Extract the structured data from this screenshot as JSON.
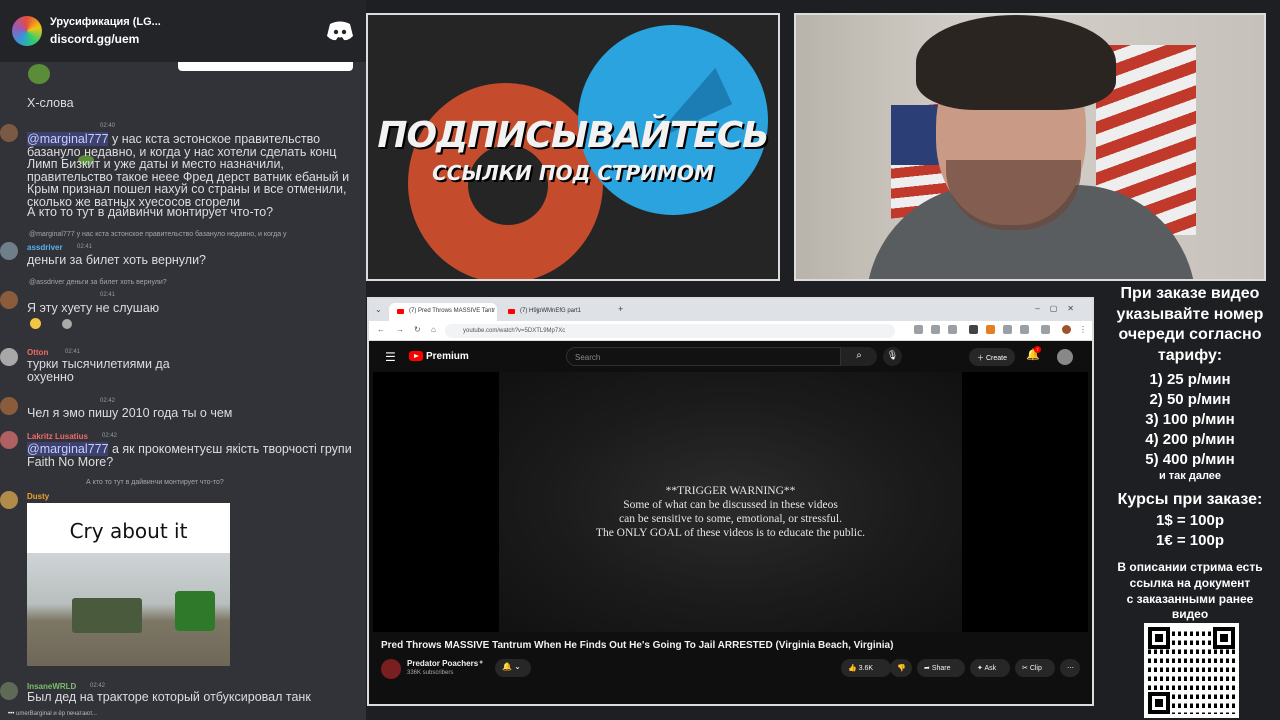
{
  "chat": {
    "server_name": "Урусификация (LG...",
    "server_link": "discord.gg/uem",
    "messages": [
      {
        "user": "",
        "time": "",
        "reply": "",
        "text": "Х-слова"
      },
      {
        "user": "",
        "time": "02:40",
        "reply": "",
        "mention": "@marginal777",
        "text": "у нас кста эстонское правительство базануло недавно, и когда у нас хотели сделать конц Лимп Бизкит и уже даты и место назначили, правительство такое неее Фред дерст ватник ебаный и Крым признал пошел нахуй со страны и все отменили, сколько же ватных хуесосов сгорели"
      },
      {
        "user": "",
        "time": "",
        "reply": "",
        "text": "А кто то тут в дайвинчи монтирует что-то?"
      },
      {
        "user": "assdriver",
        "time": "02:41",
        "reply": "@marginal777 у нас кста эстонское правительство базануло недавно, и когда у",
        "text": "деньги за билет хоть вернули?"
      },
      {
        "user": "",
        "time": "02:41",
        "reply": "@assdriver деньги за билет хоть вернули?",
        "text": "Я эту хуету не слушаю"
      },
      {
        "user": "Otton",
        "time": "02:41",
        "reply": "",
        "text": "турки тысячилетиями да охуенно"
      },
      {
        "user": "",
        "time": "02:42",
        "reply": "",
        "text": "Чел я эмо пишу 2010 года ты о чем"
      },
      {
        "user": "Lakritz Lusatius",
        "time": "02:42",
        "reply": "",
        "mention": "@marginal777",
        "text": "а як прокоментуєш якість творчості групи Faith No More?"
      },
      {
        "user": "Dusty",
        "time": "",
        "reply": "А кто то тут в дайвинчи монтирует что-то?",
        "text": ""
      },
      {
        "user": "InsaneWRLD",
        "time": "02:42",
        "reply": "",
        "text": "Был дед на тракторе который отбуксировал танк"
      }
    ],
    "meme_caption": "Cry about it",
    "typing": "umerBarginal и ёр печатают..."
  },
  "promo": {
    "title": "ПОДПИСЫВАЙТЕСЬ",
    "subtitle": "ССЫЛКИ ПОД СТРИМОМ"
  },
  "browser": {
    "tabs": [
      "(7) Pred Throws MASSIVE Tantr",
      "(7) H9jpWMnEfG part1"
    ],
    "url": "youtube.com/watch?v=5DXTL9Mp7Xc",
    "yt_brand": "Premium",
    "search_placeholder": "Search",
    "create_label": "Create",
    "notif_count": "7",
    "warning_lines": [
      "**TRIGGER WARNING**",
      "Some of what can be discussed in these videos",
      "can be sensitive to some, emotional, or stressful.",
      "The ONLY GOAL of these videos is to educate the public."
    ],
    "video_title": "Pred Throws MASSIVE Tantrum When He Finds Out He's Going To Jail ARRESTED (Virginia Beach, Virginia)",
    "channel_name": "Predator Poachers",
    "subscribers": "336K subscribers",
    "likes": "3.6K",
    "share_label": "Share",
    "ask_label": "Ask",
    "clip_label": "Clip"
  },
  "info": {
    "intro": [
      "При заказе видео",
      "указывайте номер",
      "очереди согласно",
      "тарифу:"
    ],
    "rates": [
      "1) 25 р/мин",
      "2) 50 р/мин",
      "3) 100 р/мин",
      "4) 200 р/мин",
      "5) 400 р/мин"
    ],
    "etc": "и так далее",
    "courses_title": "Курсы при заказе:",
    "courses": [
      "1$ = 100р",
      "1€ = 100р"
    ],
    "desc": [
      "В описании стрима есть",
      "ссылка на документ",
      "с заказанными ранее",
      "видео"
    ]
  }
}
